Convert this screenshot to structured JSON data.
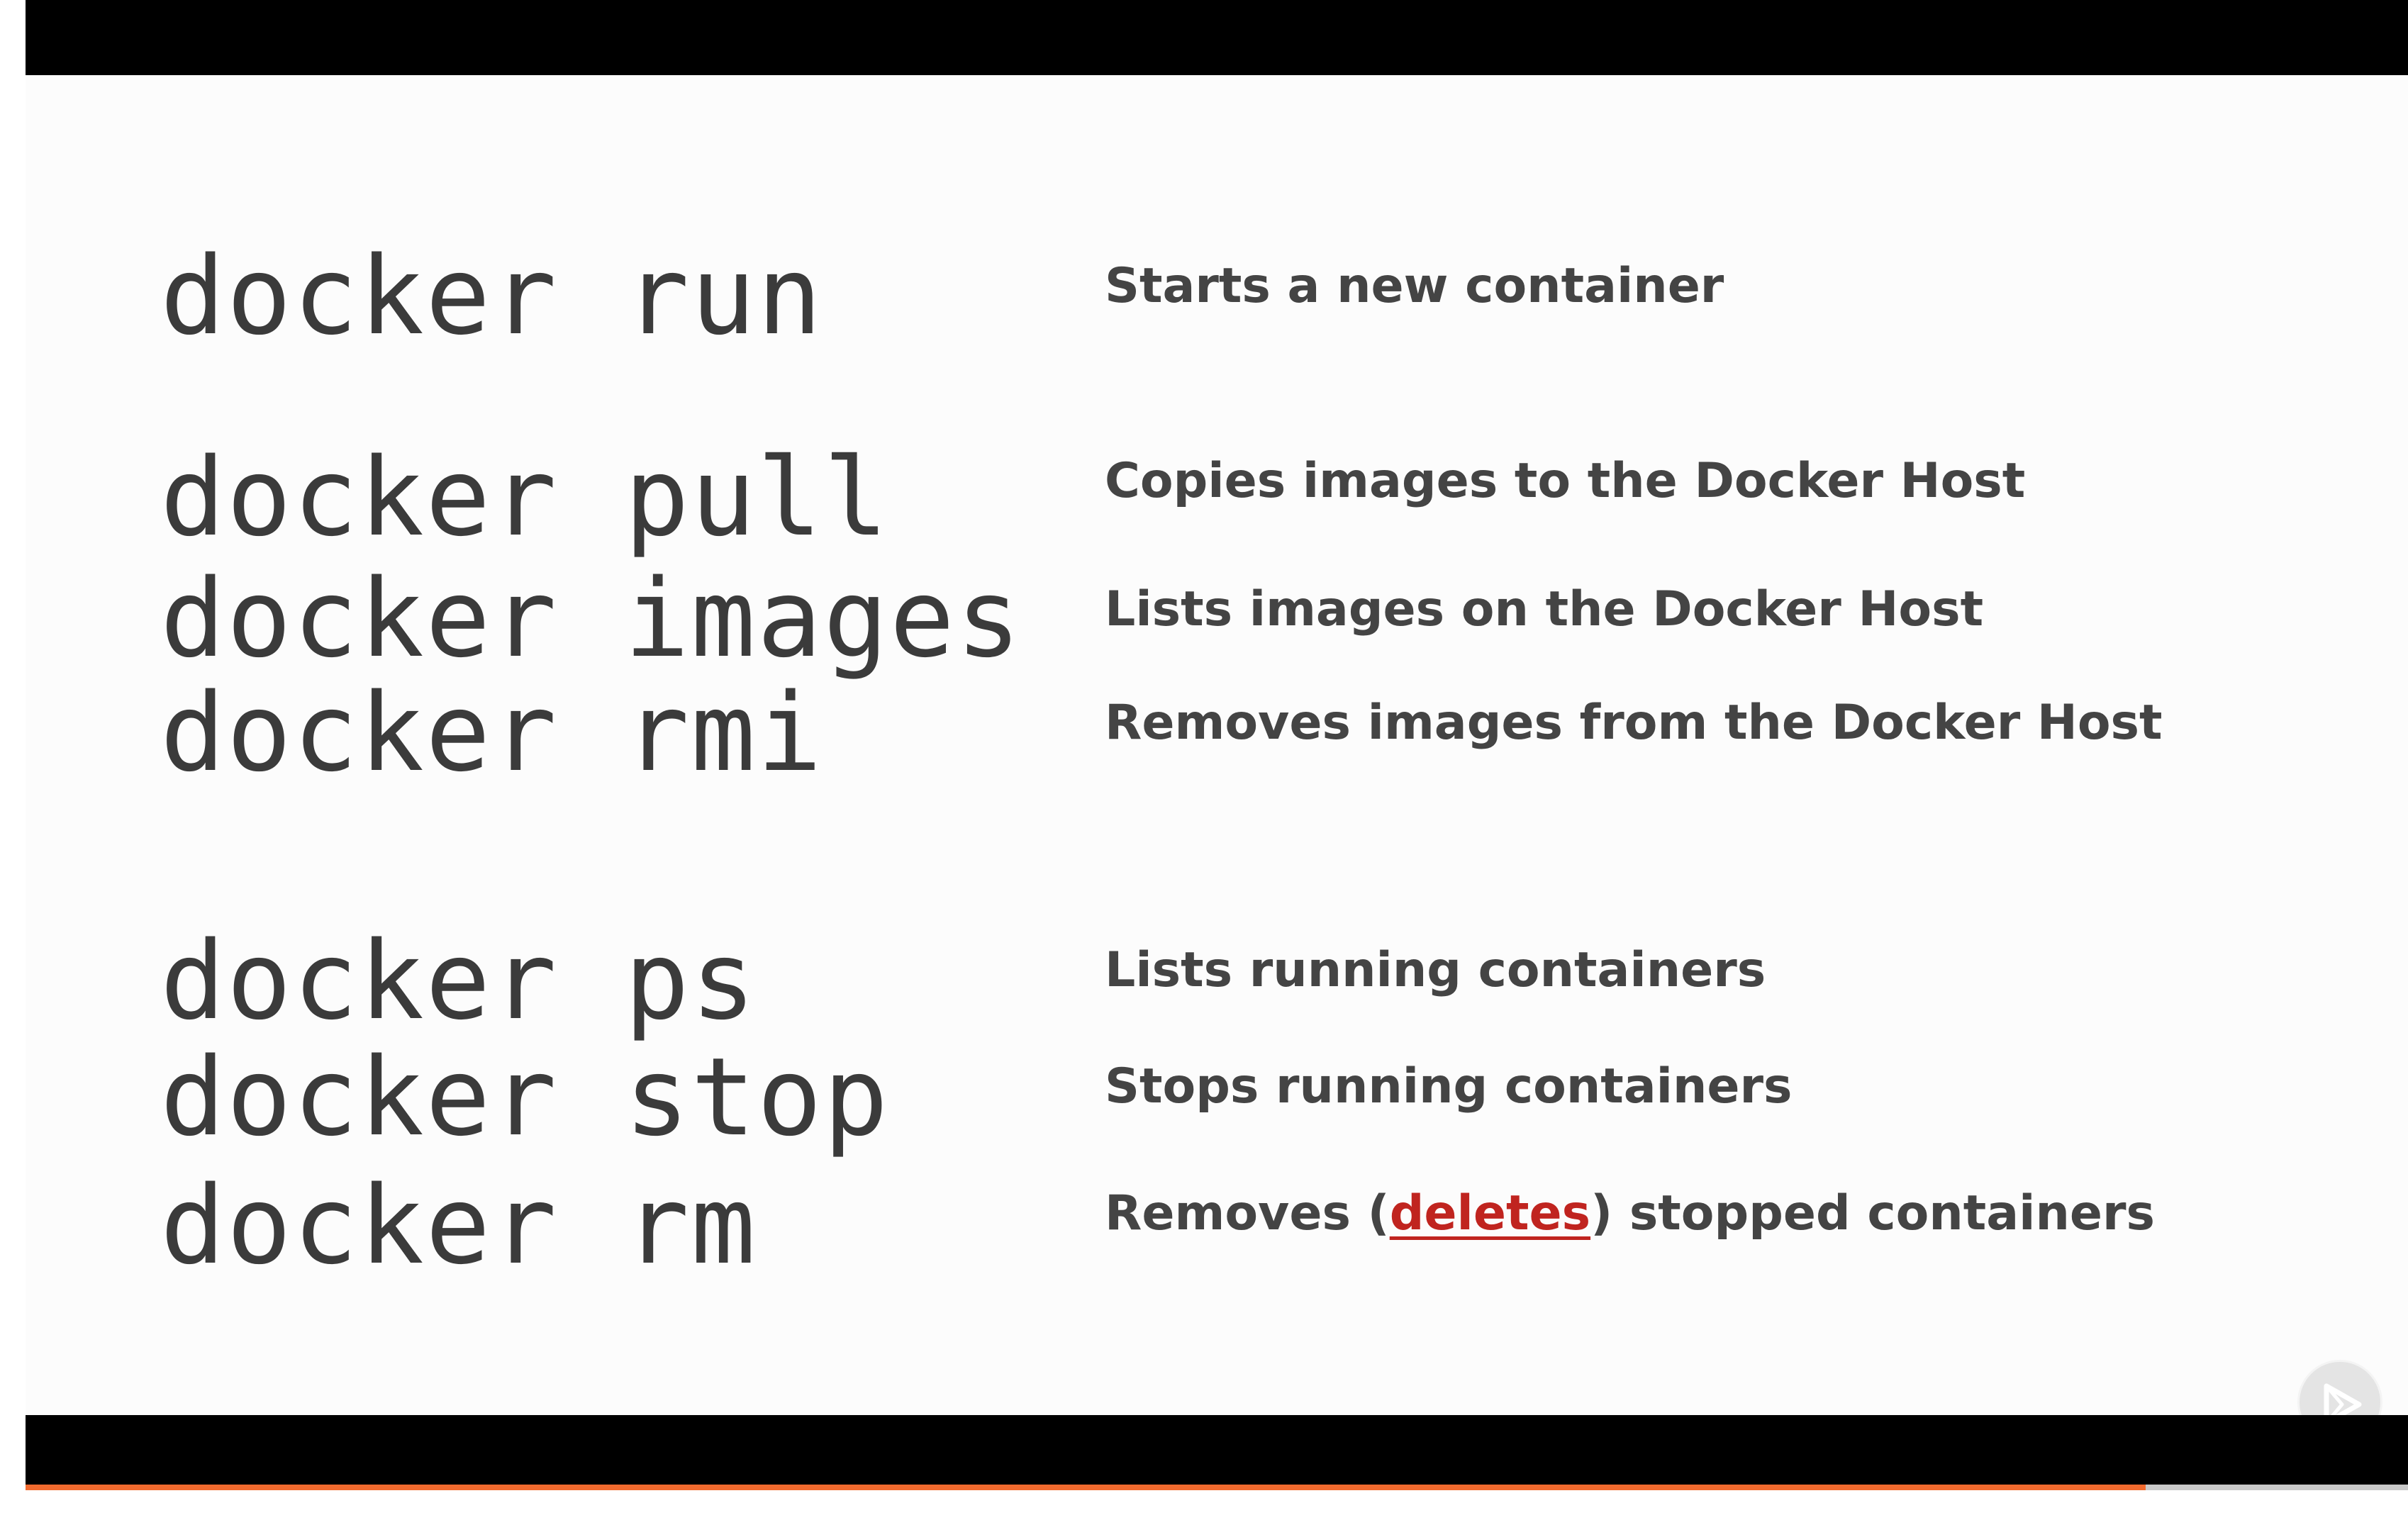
{
  "commands": [
    {
      "command": "docker run",
      "description": "Starts a new container"
    },
    {
      "command": "docker pull",
      "description": "Copies images to the Docker Host"
    },
    {
      "command": "docker images",
      "description": "Lists images on the Docker Host"
    },
    {
      "command": "docker rmi",
      "description": "Removes images from the Docker Host"
    },
    {
      "command": "docker ps",
      "description": "Lists running containers"
    },
    {
      "command": "docker stop",
      "description": "Stops running containers"
    },
    {
      "command": "docker rm",
      "description_parts": {
        "before": "Removes (",
        "highlight": "deletes",
        "after": ") stopped containers"
      }
    }
  ],
  "player": {
    "play_icon": "play-icon",
    "progress_fraction": 0.89
  },
  "colors": {
    "command_text": "#3b3b3b",
    "description_text": "#444444",
    "highlight": "#c0241f",
    "progress": "#f26a2e",
    "letterbox": "#000000"
  }
}
